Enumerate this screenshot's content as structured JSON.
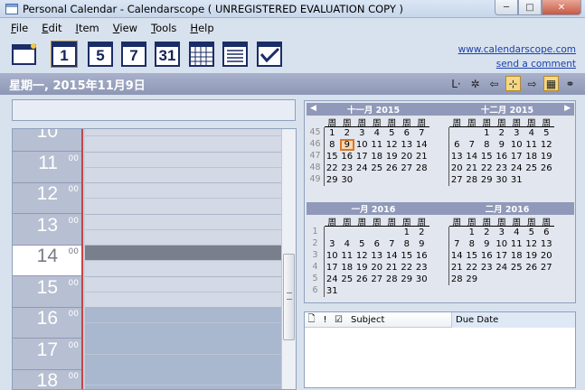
{
  "window": {
    "title": "Personal Calendar - Calendarscope ( UNREGISTERED EVALUATION COPY )",
    "min": "─",
    "max": "□",
    "close": "✕"
  },
  "menu": [
    {
      "label": "File",
      "u": "F",
      "rest": "ile"
    },
    {
      "label": "Edit",
      "u": "E",
      "rest": "dit"
    },
    {
      "label": "Item",
      "u": "I",
      "rest": "tem"
    },
    {
      "label": "View",
      "u": "V",
      "rest": "iew"
    },
    {
      "label": "Tools",
      "u": "T",
      "rest": "ools"
    },
    {
      "label": "Help",
      "u": "H",
      "rest": "elp"
    }
  ],
  "toolbar": {
    "day_num": "1",
    "workweek_num": "5",
    "week_num": "7",
    "month_num": "31"
  },
  "links": {
    "website": "www.calendarscope.com",
    "comment": "send a comment"
  },
  "datebar": {
    "date": "星期一, 2015年11月9日",
    "icons": [
      "L·",
      "✲",
      "⇦",
      "⊹",
      "⇨",
      "▦",
      "⚭"
    ]
  },
  "dayview": {
    "hours": [
      "10",
      "11",
      "12",
      "13",
      "14",
      "15",
      "16",
      "17",
      "18"
    ],
    "minutes": "00",
    "current_hour": "14"
  },
  "calendar": {
    "weekday_label": "周",
    "months": [
      {
        "title": "十一月 2015",
        "weeks": [
          {
            "wk": "45",
            "days": [
              "1",
              "2",
              "3",
              "4",
              "5",
              "6",
              "7"
            ]
          },
          {
            "wk": "46",
            "days": [
              "8",
              "9",
              "10",
              "11",
              "12",
              "13",
              "14"
            ]
          },
          {
            "wk": "47",
            "days": [
              "15",
              "16",
              "17",
              "18",
              "19",
              "20",
              "21"
            ]
          },
          {
            "wk": "48",
            "days": [
              "22",
              "23",
              "24",
              "25",
              "26",
              "27",
              "28"
            ]
          },
          {
            "wk": "49",
            "days": [
              "29",
              "30",
              "",
              "",
              "",
              "",
              ""
            ]
          }
        ],
        "today": "9"
      },
      {
        "title": "十二月 2015",
        "weeks": [
          {
            "wk": "",
            "days": [
              "",
              "",
              "1",
              "2",
              "3",
              "4",
              "5"
            ]
          },
          {
            "wk": "",
            "days": [
              "6",
              "7",
              "8",
              "9",
              "10",
              "11",
              "12"
            ]
          },
          {
            "wk": "",
            "days": [
              "13",
              "14",
              "15",
              "16",
              "17",
              "18",
              "19"
            ]
          },
          {
            "wk": "",
            "days": [
              "20",
              "21",
              "22",
              "23",
              "24",
              "25",
              "26"
            ]
          },
          {
            "wk": "",
            "days": [
              "27",
              "28",
              "29",
              "30",
              "31",
              "",
              ""
            ]
          }
        ]
      },
      {
        "title": "一月 2016",
        "weeks": [
          {
            "wk": "1",
            "days": [
              "",
              "",
              "",
              "",
              "",
              "1",
              "2"
            ]
          },
          {
            "wk": "2",
            "days": [
              "3",
              "4",
              "5",
              "6",
              "7",
              "8",
              "9"
            ]
          },
          {
            "wk": "3",
            "days": [
              "10",
              "11",
              "12",
              "13",
              "14",
              "15",
              "16"
            ]
          },
          {
            "wk": "4",
            "days": [
              "17",
              "18",
              "19",
              "20",
              "21",
              "22",
              "23"
            ]
          },
          {
            "wk": "5",
            "days": [
              "24",
              "25",
              "26",
              "27",
              "28",
              "29",
              "30"
            ]
          },
          {
            "wk": "6",
            "days": [
              "31",
              "",
              "",
              "",
              "",
              "",
              ""
            ]
          }
        ]
      },
      {
        "title": "二月 2016",
        "weeks": [
          {
            "wk": "",
            "days": [
              "",
              "1",
              "2",
              "3",
              "4",
              "5",
              "6"
            ]
          },
          {
            "wk": "",
            "days": [
              "7",
              "8",
              "9",
              "10",
              "11",
              "12",
              "13"
            ]
          },
          {
            "wk": "",
            "days": [
              "14",
              "15",
              "16",
              "17",
              "18",
              "19",
              "20"
            ]
          },
          {
            "wk": "",
            "days": [
              "21",
              "22",
              "23",
              "24",
              "25",
              "26",
              "27"
            ]
          },
          {
            "wk": "",
            "days": [
              "28",
              "29",
              "",
              "",
              "",
              "",
              ""
            ]
          }
        ]
      }
    ]
  },
  "tasks": {
    "col_subject": "Subject",
    "col_due": "Due Date"
  }
}
